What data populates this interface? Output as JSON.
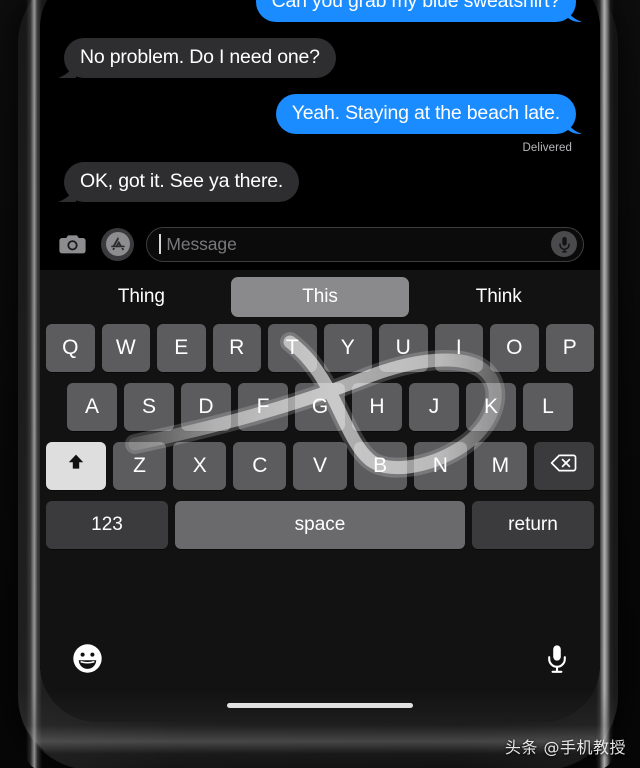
{
  "conversation": {
    "messages": [
      {
        "text": "Can you grab my blue sweatshirt?",
        "side": "out"
      },
      {
        "text": "No problem. Do I need one?",
        "side": "in"
      },
      {
        "text": "Yeah. Staying at the beach late.",
        "side": "out"
      },
      {
        "text": "OK, got it. See ya there.",
        "side": "in"
      }
    ],
    "delivered_label": "Delivered"
  },
  "input_bar": {
    "camera_icon": "camera-icon",
    "appstore_icon": "app-store-icon",
    "placeholder": "Message",
    "dictate_icon": "microphone-icon"
  },
  "keyboard": {
    "predictions": [
      {
        "label": "Thing",
        "selected": false
      },
      {
        "label": "This",
        "selected": true
      },
      {
        "label": "Think",
        "selected": false
      }
    ],
    "row1": [
      "Q",
      "W",
      "E",
      "R",
      "T",
      "Y",
      "U",
      "I",
      "O",
      "P"
    ],
    "row2": [
      "A",
      "S",
      "D",
      "F",
      "G",
      "H",
      "J",
      "K",
      "L"
    ],
    "row3": [
      "Z",
      "X",
      "C",
      "V",
      "B",
      "N",
      "M"
    ],
    "shift_icon": "shift-arrow-icon",
    "shift_active": true,
    "backspace_icon": "backspace-icon",
    "numbers_label": "123",
    "space_label": "space",
    "return_label": "return",
    "emoji_icon": "smiley-face-icon",
    "dictation_icon": "microphone-icon"
  },
  "colors": {
    "outgoing_bubble": "#1a8cff",
    "incoming_bubble": "#2e2e30",
    "key": "#5c5c5e",
    "key_fn": "#3b3b3d",
    "shift_active": "#dedede",
    "prediction_selected": "#8a8a8d"
  },
  "watermark": "头条 @手机教授"
}
